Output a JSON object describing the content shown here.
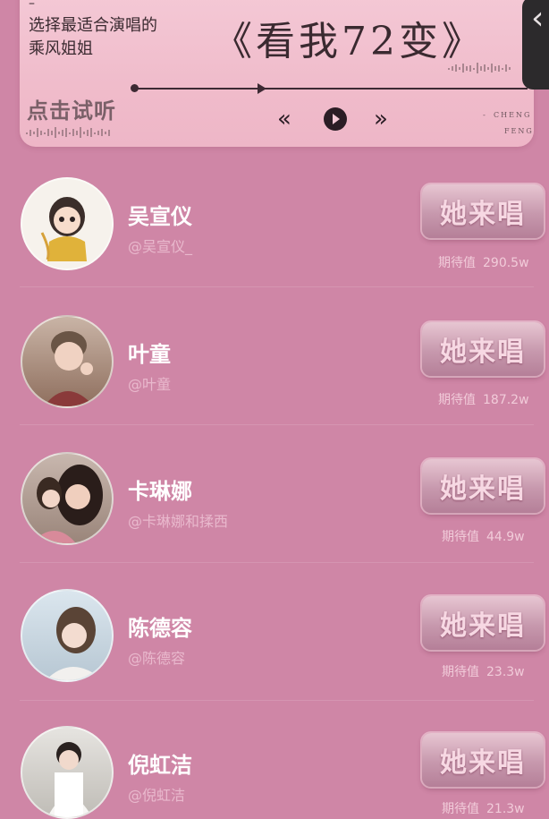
{
  "header": {
    "dash": "–",
    "prompt_line1": "选择最适合演唱的",
    "prompt_line2": "乘风姐姐",
    "song_title": "《看我72变》",
    "listen_label": "点击试听",
    "prev_icon": "double-chevron-left-icon",
    "play_icon": "play-icon",
    "next_icon": "double-chevron-right-icon",
    "brand_dash": "-",
    "brand_top": "CHENG",
    "brand_bottom": "FENG",
    "close_icon": "‹"
  },
  "button_label": "她来唱",
  "expect_label": "期待值",
  "singers": [
    {
      "name": "吴宣仪",
      "handle": "@吴宣仪_",
      "expect": "290.5w"
    },
    {
      "name": "叶童",
      "handle": "@叶童",
      "expect": "187.2w"
    },
    {
      "name": "卡琳娜",
      "handle": "@卡琳娜和揉西",
      "expect": "44.9w"
    },
    {
      "name": "陈德容",
      "handle": "@陈德容",
      "expect": "23.3w"
    },
    {
      "name": "倪虹洁",
      "handle": "@倪虹洁",
      "expect": "21.3w"
    }
  ],
  "colors": {
    "background": "#cf86a6",
    "card": "#f4c9d6",
    "text_dark": "#3a2a30"
  }
}
